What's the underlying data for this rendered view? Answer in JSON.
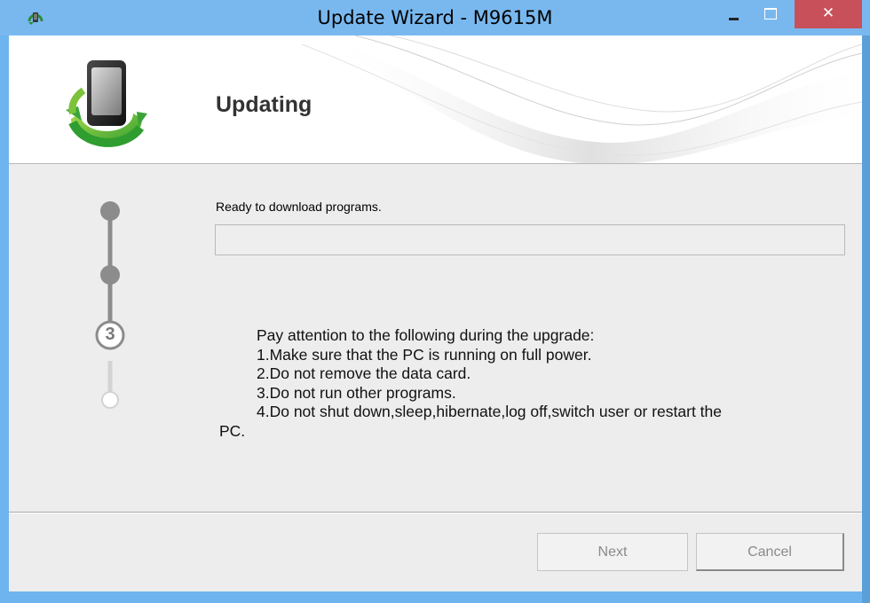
{
  "window": {
    "title": "Update Wizard - M9615M",
    "controls": {
      "minimize_icon": "minimize-icon",
      "maximize_icon": "maximize-icon",
      "close_label": "✕"
    }
  },
  "header": {
    "title": "Updating",
    "logo_icon": "phone-update-icon"
  },
  "steps": {
    "current_step_label": "3",
    "completed_color": "#8c8c8c",
    "pending_color": "#d0d0d0"
  },
  "status": {
    "text": "Ready to download programs.",
    "progress": 0
  },
  "notes": {
    "heading": "Pay attention to the following during the upgrade:",
    "item1": "1.Make sure that the PC is running on full power.",
    "item2": "2.Do not remove the data card.",
    "item3": "3.Do not run other programs.",
    "item4": "4.Do not shut down,sleep,hibernate,log off,switch user or restart the",
    "item4_tail": "PC."
  },
  "buttons": {
    "next": "Next",
    "cancel": "Cancel"
  }
}
